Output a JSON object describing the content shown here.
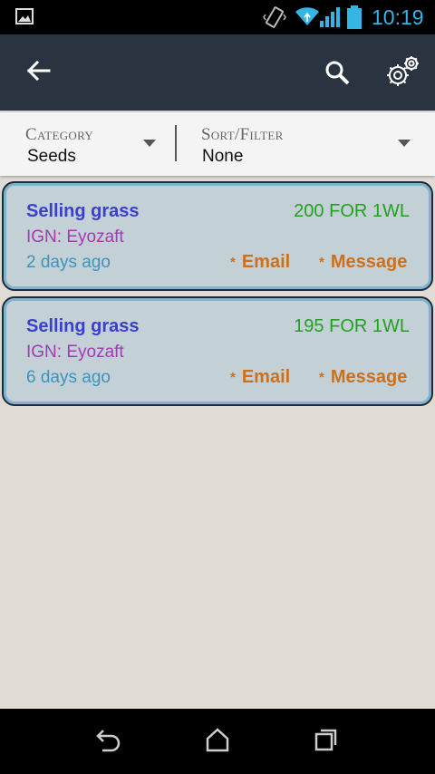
{
  "status_bar": {
    "time": "10:19",
    "icons": [
      "image-notification-icon",
      "vibrate-icon",
      "wifi-icon",
      "signal-icon",
      "battery-icon"
    ],
    "clock_color": "#33b5e5"
  },
  "action_bar": {
    "background": "#2a3440",
    "icons": [
      "back-arrow-icon",
      "search-icon",
      "settings-gear-icon"
    ]
  },
  "filters": {
    "category": {
      "label": "Category",
      "value": "Seeds"
    },
    "sort": {
      "label": "Sort/Filter",
      "value": "None"
    }
  },
  "listings": [
    {
      "title": "Selling grass",
      "price": "200 FOR 1WL",
      "ign_label": "IGN:",
      "ign_name": "Eyozaft",
      "age": "2 days ago",
      "email_label": "Email",
      "message_label": "Message"
    },
    {
      "title": "Selling grass",
      "price": "195 FOR 1WL",
      "ign_label": "IGN:",
      "ign_name": "Eyozaft",
      "age": "6 days ago",
      "email_label": "Email",
      "message_label": "Message"
    }
  ],
  "colors": {
    "title": "#3b3fc9",
    "price": "#22a022",
    "ign": "#a33ab0",
    "age": "#3d93ba",
    "action": "#c9711f",
    "card_bg": "#c3d0d6",
    "page_bg": "#e1dbd6"
  },
  "nav_bar": {
    "icons": [
      "back-nav-icon",
      "home-nav-icon",
      "recents-nav-icon"
    ]
  }
}
